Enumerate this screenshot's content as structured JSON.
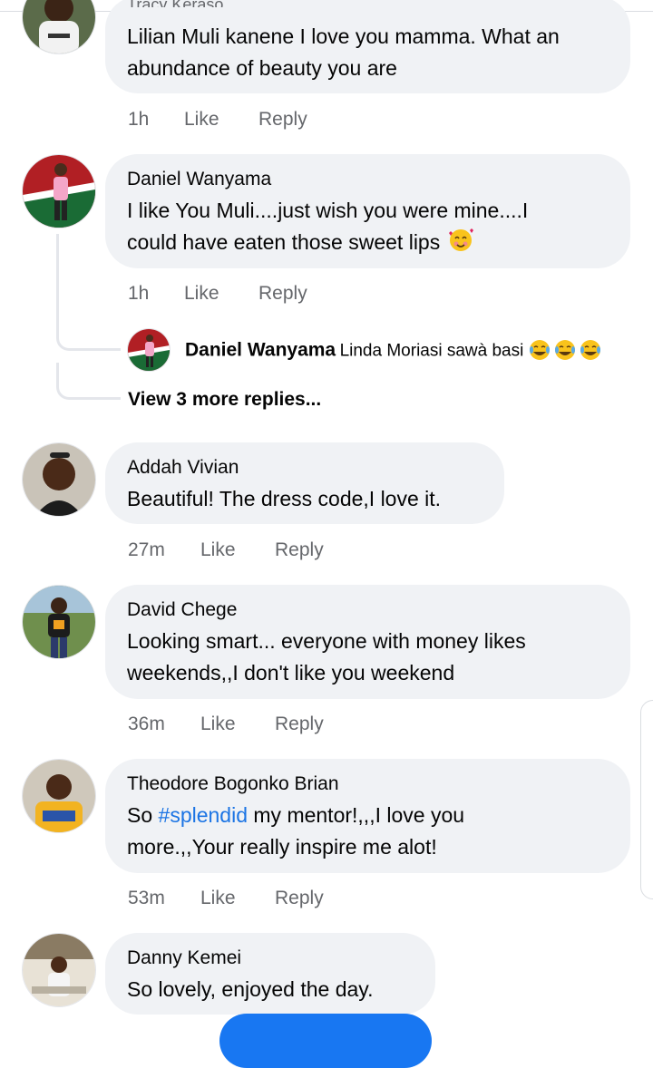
{
  "comments": [
    {
      "name": "Tracy Keraso",
      "lines": [
        "Lilian Muli kanene I love you mamma. What an",
        "abundance of beauty you are"
      ],
      "time": "1h",
      "like": "Like",
      "reply": "Reply"
    },
    {
      "name": "Daniel Wanyama",
      "lines": [
        "I like You Muli....just wish you were mine....I",
        "could have eaten those sweet lips"
      ],
      "time": "1h",
      "like": "Like",
      "reply": "Reply",
      "reply_preview": {
        "name": "Daniel Wanyama",
        "text": "Linda Moriasi sawà basi"
      },
      "view_more": "View 3 more replies..."
    },
    {
      "name": "Addah Vivian",
      "lines": [
        "Beautiful! The dress code,I love it."
      ],
      "time": "27m",
      "like": "Like",
      "reply": "Reply"
    },
    {
      "name": "David Chege",
      "lines": [
        "Looking smart... everyone with money likes",
        "weekends,,I don't like you weekend"
      ],
      "time": "36m",
      "like": "Like",
      "reply": "Reply"
    },
    {
      "name": "Theodore Bogonko Brian",
      "line1_pre": "So ",
      "hashtag": "#splendid",
      "line1_post": " my mentor!,,,I love you",
      "line2": "more.,,Your really inspire me alot!",
      "time": "53m",
      "like": "Like",
      "reply": "Reply"
    },
    {
      "name": "Danny Kemei",
      "lines": [
        "So lovely, enjoyed the day."
      ]
    }
  ],
  "colors": {
    "bubble": "#f0f2f5",
    "meta": "#65676b",
    "hashtag": "#1b74e4",
    "fab": "#1877f2"
  },
  "icons": {
    "heart_face": "smiling-face-with-hearts-icon",
    "laugh": "tears-of-joy-icon"
  }
}
